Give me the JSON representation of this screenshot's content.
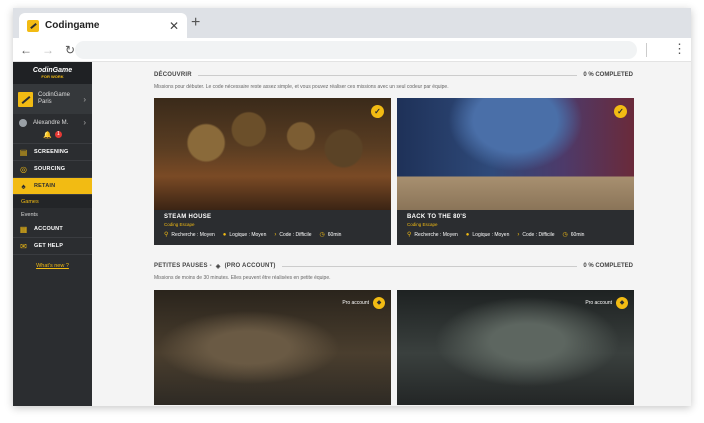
{
  "browser": {
    "tab_title": "Codingame",
    "close_glyph": "✕",
    "new_tab_glyph": "+",
    "back_glyph": "←",
    "forward_glyph": "→",
    "reload_glyph": "↻",
    "menu_glyph": "⋮"
  },
  "sidebar": {
    "brand_name": "CodinGame",
    "brand_sub": "FOR WORK",
    "company_name": "CodinGame",
    "company_city": "Paris",
    "chevron": "›",
    "user_name": "Alexandre M.",
    "notifications": "1",
    "menu": [
      {
        "label": "SCREENING",
        "icon": "screening-icon"
      },
      {
        "label": "SOURCING",
        "icon": "sourcing-icon"
      },
      {
        "label": "RETAIN",
        "icon": "retain-icon"
      }
    ],
    "submenu": [
      {
        "label": "Games"
      },
      {
        "label": "Events"
      }
    ],
    "menu2": [
      {
        "label": "ACCOUNT",
        "icon": "account-icon"
      },
      {
        "label": "GET HELP",
        "icon": "help-icon"
      }
    ],
    "whats_new": "What's new ?"
  },
  "main": {
    "discover": {
      "title": "DÉCOUVRIR",
      "progress": "0 % COMPLETED",
      "description": "Missions pour débuter. Le code nécessaire reste assez simple, et vous pouvez réaliser ces missions avec un seul codeur par équipe."
    },
    "pauses": {
      "title": "PETITES PAUSES -",
      "title_suffix": "(PRO ACCOUNT)",
      "progress": "0 % COMPLETED",
      "description": "Missions de moins de 30 minutes. Elles peuvent être réalisées en petite équipe."
    },
    "cards": [
      {
        "title": "STEAM HOUSE",
        "subtitle": "Coding Escape",
        "stats": [
          "Recherche : Moyen",
          "Logique : Moyen",
          "Code : Difficile",
          "60min"
        ]
      },
      {
        "title": "BACK TO THE 80'S",
        "subtitle": "Coding Escape",
        "stats": [
          "Recherche : Moyen",
          "Logique : Moyen",
          "Code : Difficile",
          "60min"
        ]
      }
    ],
    "pro_label": "Pro account",
    "check_glyph": "✓"
  },
  "colors": {
    "accent": "#f2bb13",
    "sidebar_bg": "#2b2d30",
    "content_bg": "#f4f4f4"
  }
}
